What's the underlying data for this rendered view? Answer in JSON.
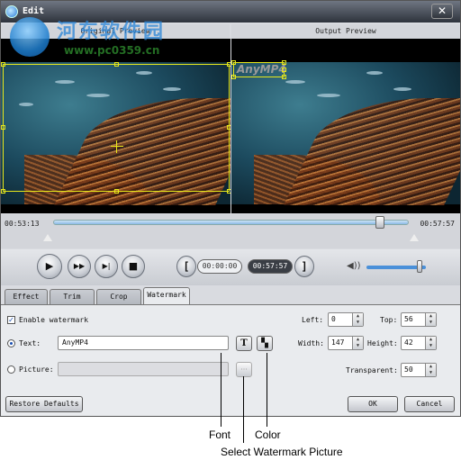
{
  "window": {
    "title": "Edit",
    "close_glyph": "✕"
  },
  "site_watermark": {
    "chinese": "河东软件园",
    "url": "www.pc0359.cn"
  },
  "panes": {
    "original_label": "Original Preview",
    "output_label": "Output Preview",
    "watermark_preview_text": "AnyMP4"
  },
  "timeline": {
    "start_time": "00:53:13",
    "end_time": "00:57:57",
    "progress": 0.92
  },
  "player": {
    "play_glyph": "▶",
    "forward_glyph": "▶▶",
    "next_frame_glyph": "▶|",
    "stop_glyph": "■",
    "left_bracket": "[",
    "right_bracket": "]",
    "start_time": "00:00:00",
    "end_time": "00:57:57",
    "volume": 0.9,
    "volume_glyph": "◀))"
  },
  "tabs": [
    {
      "label": "Effect"
    },
    {
      "label": "Trim"
    },
    {
      "label": "Crop"
    },
    {
      "label": "Watermark",
      "active": true
    }
  ],
  "watermark": {
    "enable_label": "Enable watermark",
    "enable_checked": "✓",
    "text_label": "Text:",
    "text_value": "AnyMP4",
    "font_glyph": "T",
    "color_glyph": "▚",
    "picture_label": "Picture:",
    "picture_value": "",
    "browse_glyph": "···",
    "left_label": "Left:",
    "left_value": "0",
    "top_label": "Top:",
    "top_value": "56",
    "width_label": "Width:",
    "width_value": "147",
    "height_label": "Height:",
    "height_value": "42",
    "transparent_label": "Transparent:",
    "transparent_value": "50"
  },
  "buttons": {
    "restore_defaults": "Restore Defaults",
    "ok": "OK",
    "cancel": "Cancel"
  },
  "annotations": {
    "font": "Font",
    "color": "Color",
    "select_picture": "Select Watermark Picture"
  },
  "colors": {
    "accent": "#4a90d9",
    "crop_outline": "#e8e81a"
  }
}
